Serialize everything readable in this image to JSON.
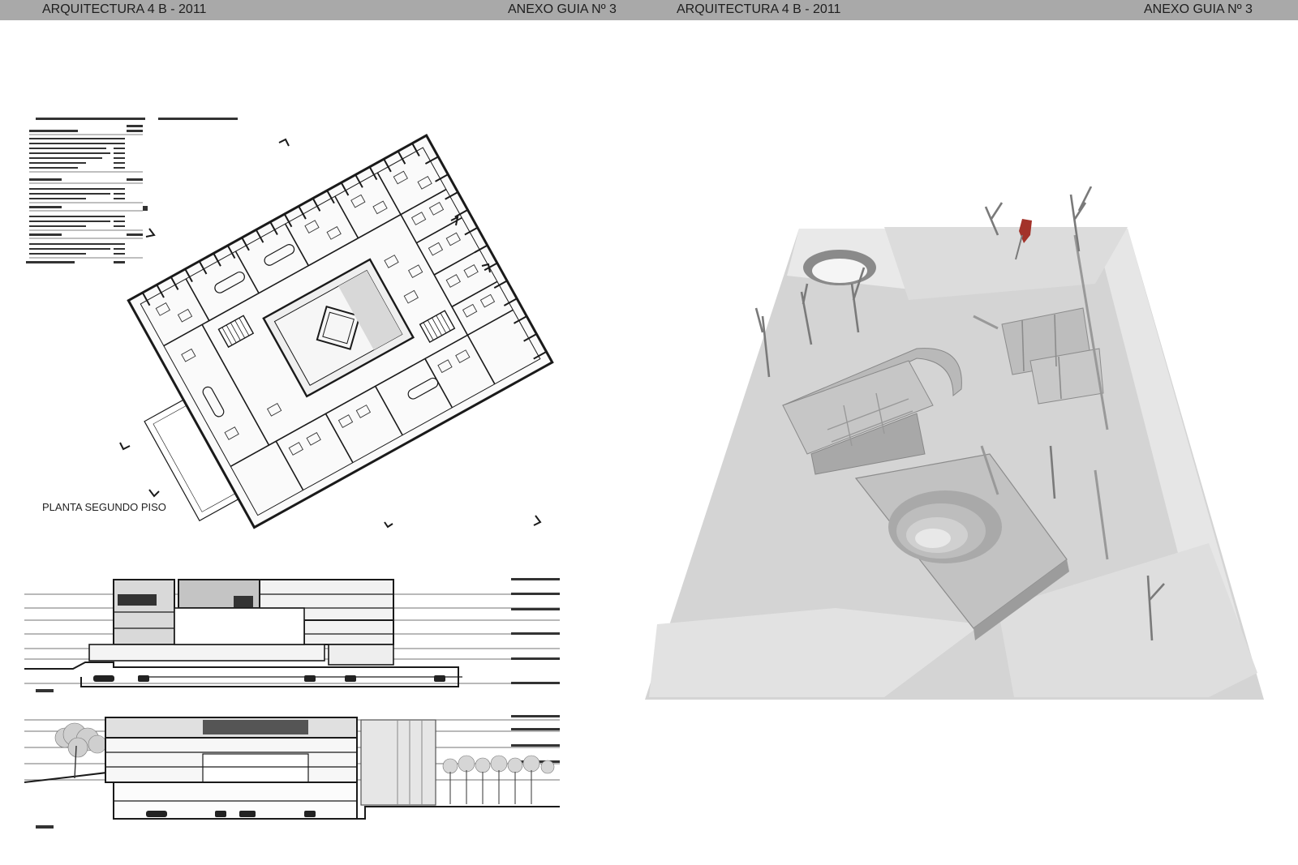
{
  "header": {
    "left_page": {
      "title": "ARQUITECTURA 4 B - 2011",
      "annex": "ANEXO GUIA Nº 3"
    },
    "right_page": {
      "title": "ARQUITECTURA 4 B - 2011",
      "annex": "ANEXO GUIA Nº 3"
    }
  },
  "plan": {
    "caption": "PLANTA SEGUNDO PISO"
  },
  "colors": {
    "header_bar": "#a9a9a9",
    "drawing_line": "#1a1a1a",
    "model_base": "#d9d9d9",
    "model_highlight": "#efefef",
    "accent_red": "#a3322a"
  }
}
